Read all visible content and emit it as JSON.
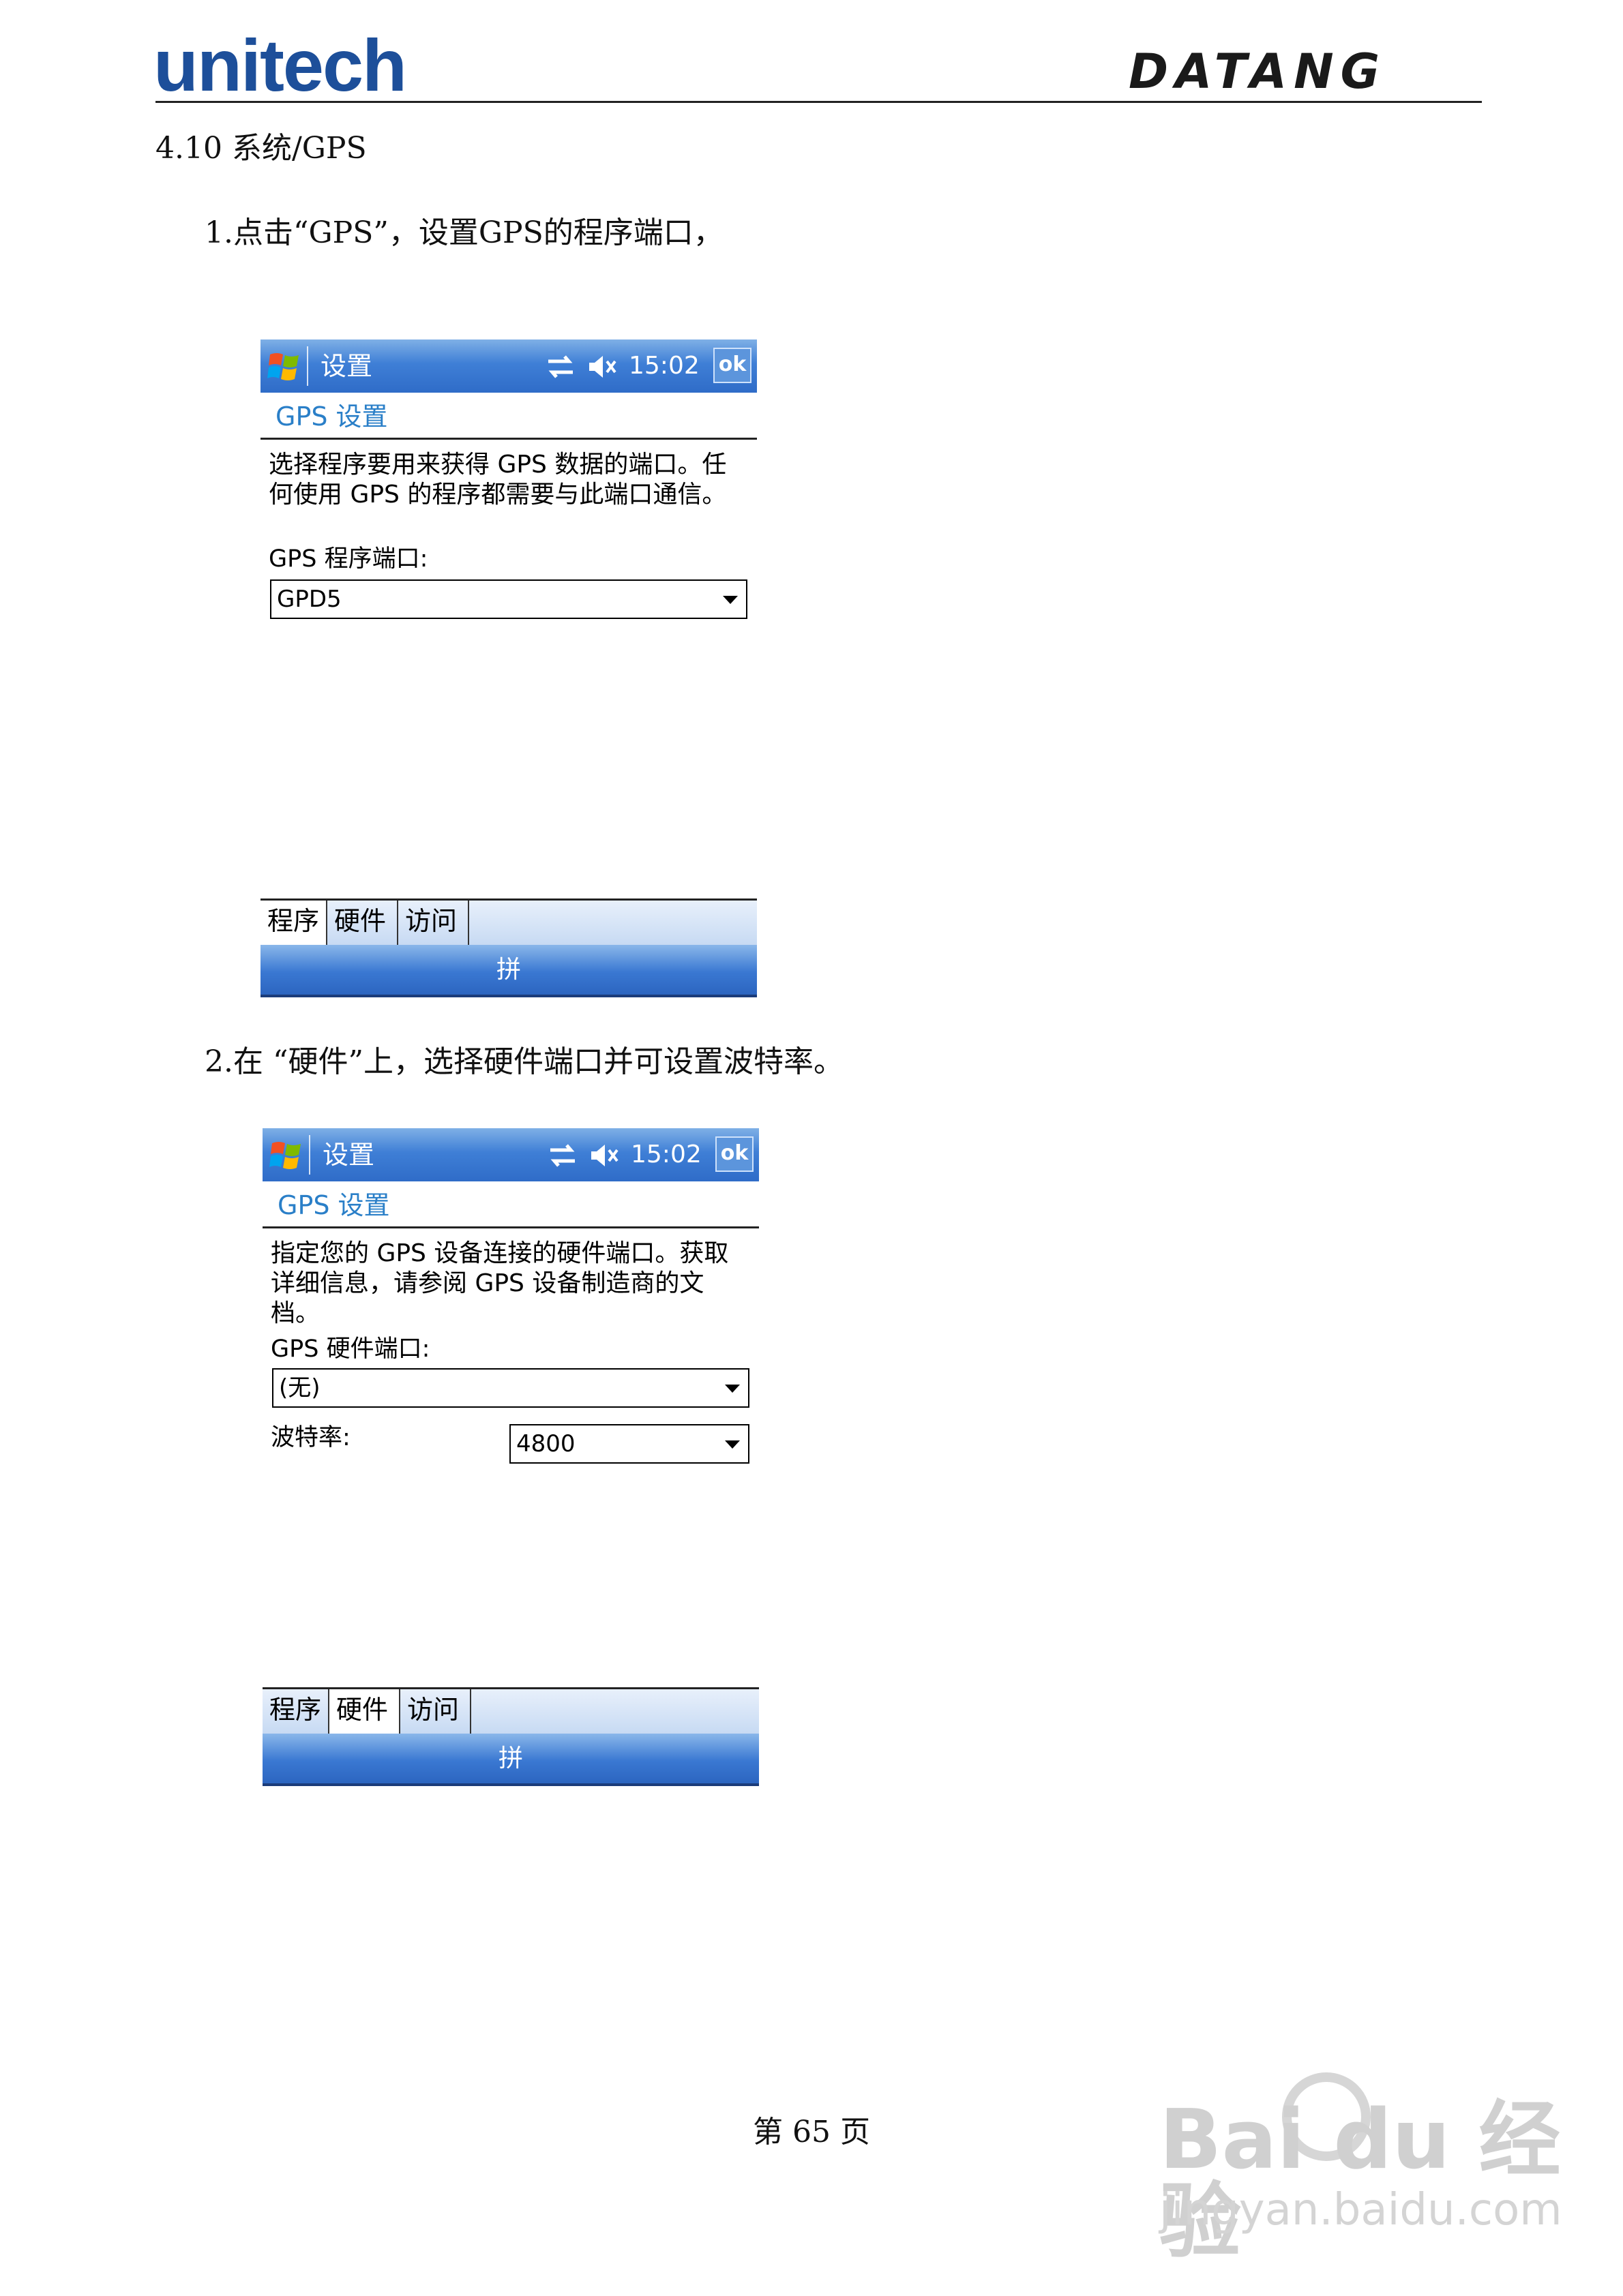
{
  "header": {
    "brand_left": "unitech",
    "brand_right": "DATANG"
  },
  "section_title": "4.10   系统/GPS",
  "steps": [
    "1.点击“GPS”，设置GPS的程序端口，",
    "2.在 “硬件”上，选择硬件端口并可设置波特率。"
  ],
  "screens": [
    {
      "title": "设置",
      "time": "15:02",
      "ok_label": "ok",
      "page_heading": "GPS 设置",
      "description": "选择程序要用来获得 GPS 数据的端口。任何使用 GPS 的程序都需要与此端口通信。",
      "field_label": "GPS 程序端口:",
      "field_value": "GPD5",
      "tabs": [
        "程序",
        "硬件",
        "访问"
      ],
      "active_tab": 0,
      "sip_label": "拼"
    },
    {
      "title": "设置",
      "time": "15:02",
      "ok_label": "ok",
      "page_heading": "GPS 设置",
      "description": "指定您的 GPS 设备连接的硬件端口。获取详细信息，请参阅 GPS 设备制造商的文档。",
      "field_label": "GPS 硬件端口:",
      "field_value": "(无)",
      "baud_label": "波特率:",
      "baud_value": "4800",
      "tabs": [
        "程序",
        "硬件",
        "访问"
      ],
      "active_tab": 1,
      "sip_label": "拼"
    }
  ],
  "page_number": "第 65 页",
  "watermark": {
    "logo": "Bai du 经验",
    "url": "jingyan.baidu.com"
  },
  "colors": {
    "unitech_blue": "#1d4f9a",
    "title_bar_blue": "#3f7fd6",
    "heading_blue": "#2a7fc8"
  }
}
